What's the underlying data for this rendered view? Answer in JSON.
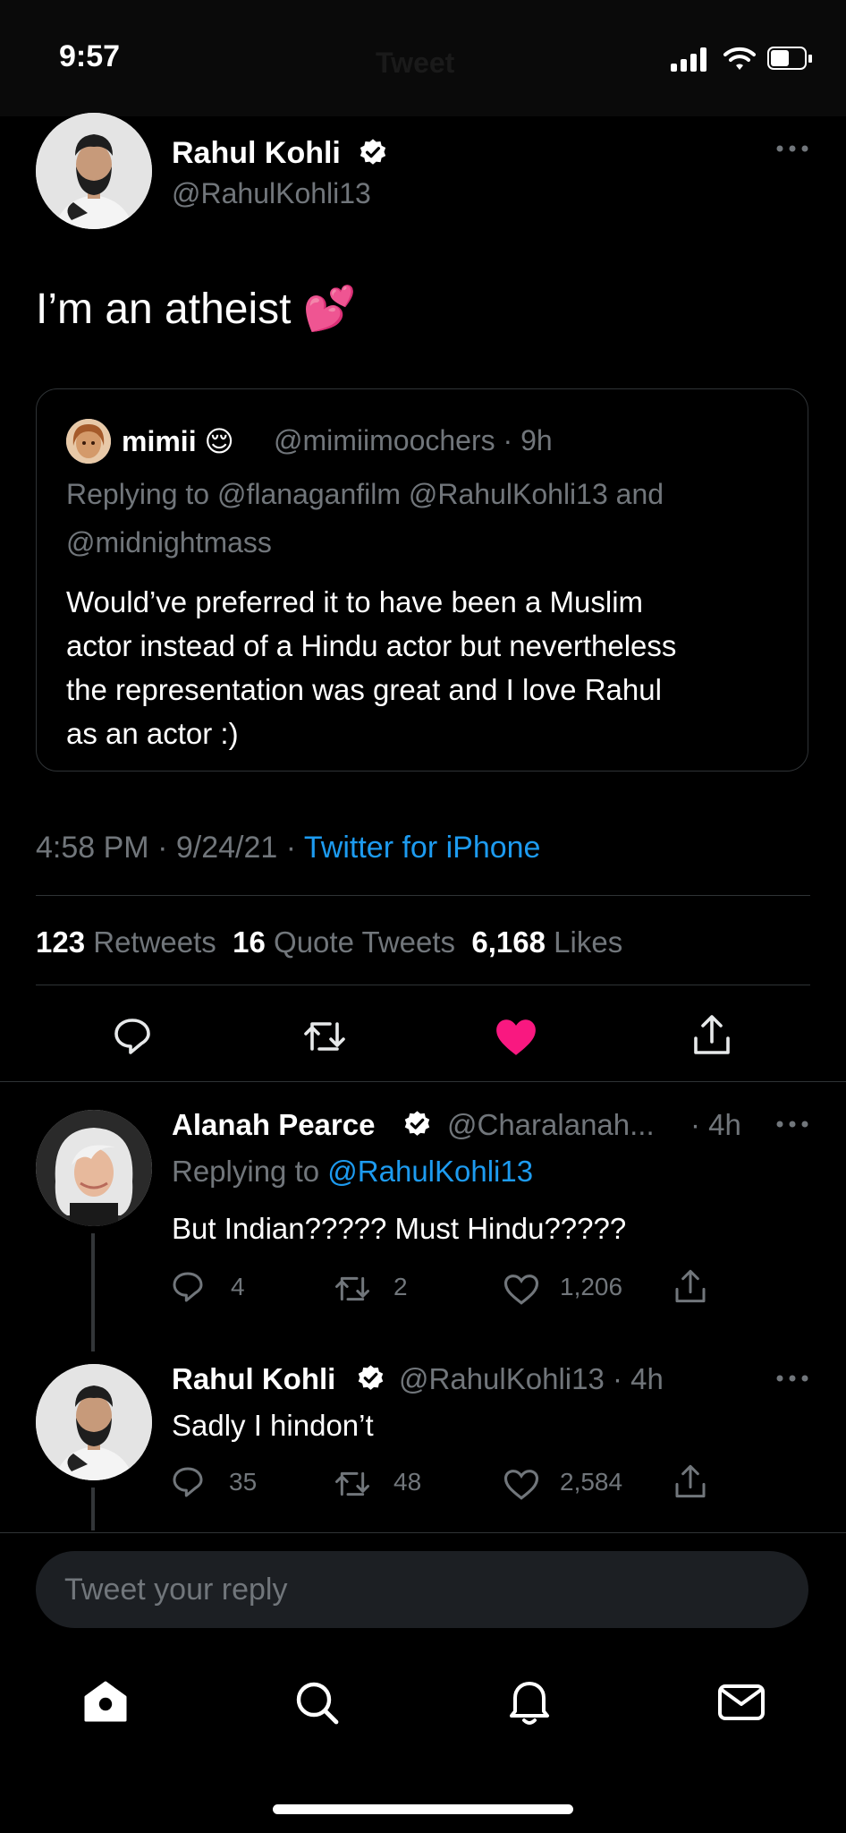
{
  "status_bar": {
    "time": "9:57",
    "ghost_title": "Tweet"
  },
  "main_tweet": {
    "author_name": "Rahul Kohli",
    "author_handle": "@RahulKohli13",
    "text": "I’m an atheist 💕",
    "quoted": {
      "author_name": "mimii 😌",
      "author_handle": "@mimiimoochers · 9h",
      "replying_prefix": "Replying to",
      "replying_line1": "@flanaganfilm @RahulKohli13",
      "replying_and": "and",
      "replying_line2": "@midnightmass",
      "text_lines": [
        "Would’ve preferred it to have been a Muslim",
        "actor instead of a Hindu actor but nevertheless",
        "the representation was great and I love Rahul",
        "as an actor :)"
      ]
    },
    "timestamp": "4:58 PM · 9/24/21 ·",
    "source": "Twitter for iPhone",
    "stats": {
      "retweets_count": "123",
      "retweets_label": "Retweets",
      "quotes_count": "16",
      "quotes_label": "Quote Tweets",
      "likes_count": "6,168",
      "likes_label": "Likes"
    },
    "liked": true,
    "like_color": "#f91880"
  },
  "replies": [
    {
      "author_name": "Alanah Pearce",
      "author_handle": "@Charalanah...",
      "time": "· 4h",
      "replying_prefix": "Replying to",
      "replying_to": "@RahulKohli13",
      "text": "But Indian????? Must Hindu?????",
      "reply_count": "4",
      "retweet_count": "2",
      "like_count": "1,206"
    },
    {
      "author_name": "Rahul Kohli",
      "author_handle": "@RahulKohli13 · 4h",
      "text": "Sadly I hindon’t",
      "reply_count": "35",
      "retweet_count": "48",
      "like_count": "2,584"
    }
  ],
  "reply_bar": {
    "placeholder": "Tweet your reply"
  },
  "tab_bar": {
    "items": [
      "home-icon",
      "search-icon",
      "notifications-icon",
      "messages-icon"
    ]
  },
  "colors": {
    "accent": "#1d9bf0",
    "like": "#f91880",
    "verified": "#ffffff",
    "muted": "#71767b"
  }
}
